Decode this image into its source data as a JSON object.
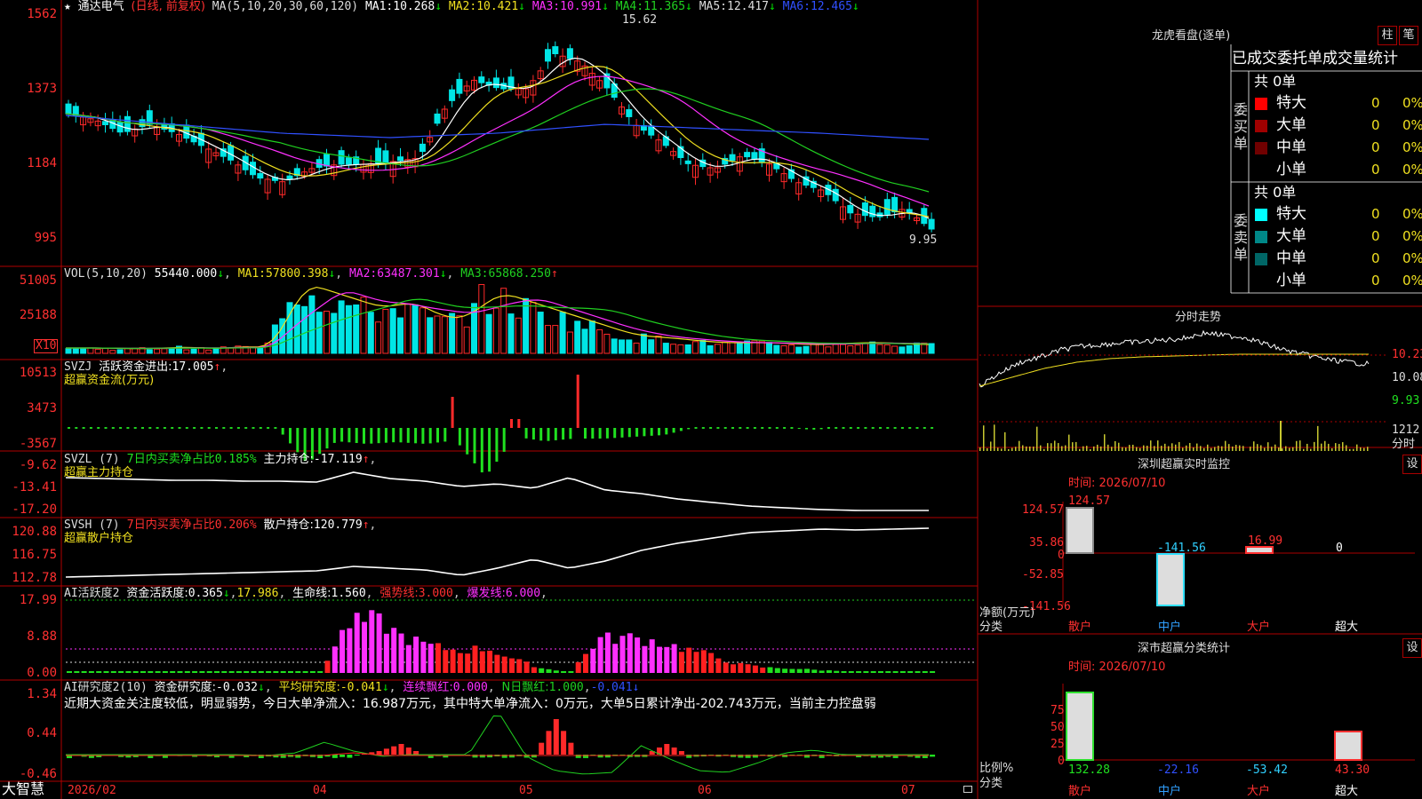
{
  "app": {
    "name": "大智慧"
  },
  "colors": {
    "up": "#ff2a2a",
    "down": "#00e5e5",
    "bg": "#000000",
    "grid": "#b00000",
    "ma1": "#ffffff",
    "ma2": "#f0e020",
    "ma3": "#ff30ff",
    "ma4": "#20d020",
    "ma5": "#3050ff"
  },
  "kline": {
    "star": "★",
    "stock": "通达电气",
    "period": "(日线, 前复权)",
    "ma_label": "MA(5,10,20,30,60,120)",
    "ma": [
      {
        "label": "MA1:",
        "value": "10.268",
        "arrow": "↓"
      },
      {
        "label": "MA2:",
        "value": "10.421",
        "arrow": "↓"
      },
      {
        "label": "MA3:",
        "value": "10.991",
        "arrow": "↓"
      },
      {
        "label": "MA4:",
        "value": "11.365",
        "arrow": "↓"
      },
      {
        "label": "MA5:",
        "value": "12.417",
        "arrow": "↓"
      },
      {
        "label": "MA6:",
        "value": "12.465",
        "arrow": "↓"
      }
    ],
    "y_ticks": [
      "1562",
      "1373",
      "1184",
      "995"
    ],
    "high_label": "15.62",
    "low_label": "9.95"
  },
  "vol": {
    "title": "VOL(5,10,20)",
    "value": "55440.000",
    "ma": [
      {
        "label": "MA1:",
        "value": "57800.398",
        "arrow": "↓"
      },
      {
        "label": "MA2:",
        "value": "63487.301",
        "arrow": "↓"
      },
      {
        "label": "MA3:",
        "value": "65868.250",
        "arrow": "↑"
      }
    ],
    "y_ticks": [
      "51005",
      "25188"
    ],
    "unit": "X10"
  },
  "svzj": {
    "title": "SVZJ",
    "label": "活跃资金进出:",
    "value": "17.005",
    "arrow": "↑",
    "subtitle": "超赢资金流(万元)",
    "y_ticks": [
      "10513",
      "3473",
      "-3567"
    ]
  },
  "svzl": {
    "title": "SVZL (7)",
    "ratio_label": "7日内买卖净占比",
    "ratio": "0.185%",
    "label": "主力持仓:",
    "value": "-17.119",
    "arrow": "↑",
    "subtitle": "超赢主力持仓",
    "y_ticks": [
      "-9.62",
      "-13.41",
      "-17.20"
    ]
  },
  "svsh": {
    "title": "SVSH (7)",
    "ratio_label": "7日内买卖净占比",
    "ratio": "0.206%",
    "label": "散户持仓:",
    "value": "120.779",
    "arrow": "↑",
    "subtitle": "超赢散户持仓",
    "y_ticks": [
      "120.88",
      "116.75",
      "112.78"
    ]
  },
  "ai_active": {
    "title": "AI活跃度2",
    "l1": "资金活跃度:",
    "v1": "0.365",
    "a1": "↓",
    "v1b": "17.986",
    "l2": "生命线:",
    "v2": "1.560",
    "l3": "强势线:",
    "v3": "3.000",
    "l4": "爆发线:",
    "v4": "6.000",
    "y_ticks": [
      "17.99",
      "8.88",
      "0.00"
    ]
  },
  "ai_research": {
    "title": "AI研究度2(10)",
    "l1": "资金研究度:",
    "v1": "-0.032",
    "a1": "↓",
    "l2": "平均研究度:",
    "v2": "-0.041",
    "a2": "↓",
    "l3": "连续飘红:",
    "v3": "0.000",
    "l4": "N日飘红:",
    "v4": "1.000",
    "v5": "-0.041",
    "a5": "↓",
    "comment": "近期大资金关注度较低，明显弱势，今日大单净流入：16.987万元，其中特大单净流入：0万元，大单5日累计净出-202.743万元，当前主力控盘弱",
    "y_ticks": [
      "1.34",
      "0.44",
      "-0.46"
    ]
  },
  "xaxis": {
    "labels": [
      "2026/02",
      "04",
      "05",
      "06",
      "07"
    ]
  },
  "dragon": {
    "title": "龙虎看盘(逐单)",
    "btn_zhu": "柱",
    "btn_bi": "笔",
    "header": "已成交委托单成交量统计",
    "buy_side": "委买单",
    "sell_side": "委卖单",
    "buy_total": "共 0单",
    "sell_total": "共 0单",
    "buy_rows": [
      {
        "name": "特大",
        "count": "0",
        "pct": "0%",
        "color": "#ff0000"
      },
      {
        "name": "大单",
        "count": "0",
        "pct": "0%",
        "color": "#a00000"
      },
      {
        "name": "中单",
        "count": "0",
        "pct": "0%",
        "color": "#700000"
      },
      {
        "name": "小单",
        "count": "0",
        "pct": "0%",
        "color": "#000000"
      }
    ],
    "sell_rows": [
      {
        "name": "特大",
        "count": "0",
        "pct": "0%",
        "color": "#00ffff"
      },
      {
        "name": "大单",
        "count": "0",
        "pct": "0%",
        "color": "#008888"
      },
      {
        "name": "中单",
        "count": "0",
        "pct": "0%",
        "color": "#006666"
      },
      {
        "name": "小单",
        "count": "0",
        "pct": "0%",
        "color": "#000000"
      }
    ]
  },
  "minute": {
    "title": "分时走势",
    "prices": [
      "10.23",
      "10.08",
      "9.93"
    ],
    "vol_label": "1212",
    "vol_unit": "分时"
  },
  "sz_monitor": {
    "title": "深圳超赢实时监控",
    "btn": "设",
    "time_label": "时间: 2026/07/10",
    "y_ticks": [
      "124.57",
      "35.86",
      "0",
      "-52.85",
      "-141.56"
    ],
    "axis_unit": "净额(万元)",
    "axis_cat": "分类",
    "categories": [
      "散户",
      "中户",
      "大户",
      "超大"
    ],
    "values": [
      "124.57",
      "-141.56",
      "16.99",
      "0"
    ]
  },
  "sz_class": {
    "title": "深市超赢分类统计",
    "btn": "设",
    "time_label": "时间: 2026/07/10",
    "y_ticks": [
      "75",
      "50",
      "25",
      "0"
    ],
    "axis_unit": "比例%",
    "axis_cat": "分类",
    "categories": [
      "散户",
      "中户",
      "大户",
      "超大"
    ],
    "values": [
      "132.28",
      "-22.16",
      "-53.42",
      "43.30"
    ]
  }
}
